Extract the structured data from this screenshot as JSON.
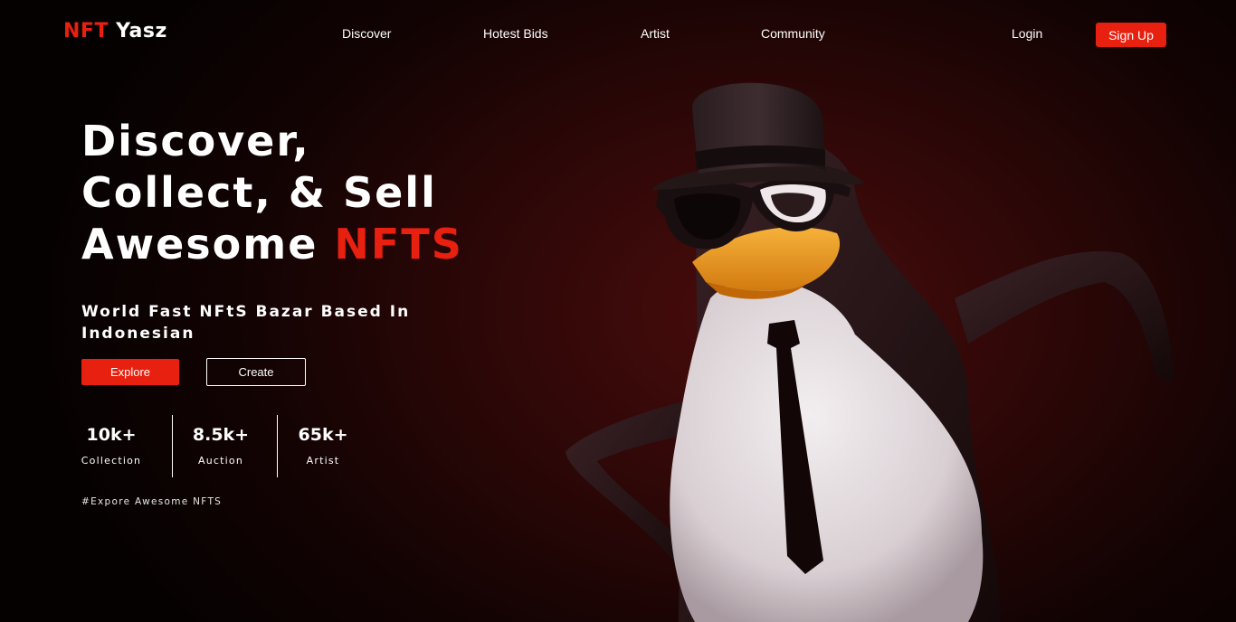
{
  "header": {
    "logo_accent": "NFT",
    "logo_rest": "Yasz",
    "nav": [
      "Discover",
      "Hotest Bids",
      "Artist",
      "Community"
    ],
    "login_label": "Login",
    "signup_label": "Sign Up"
  },
  "hero": {
    "title_line1": "Discover,",
    "title_line2": "Collect, & Sell",
    "title_line3_prefix": "Awesome ",
    "title_line3_accent": "NFTS",
    "subtitle": "World Fast NFtS Bazar Based In Indonesian",
    "explore_label": "Explore",
    "create_label": "Create",
    "stats": [
      {
        "value": "10k+",
        "label": "Collection"
      },
      {
        "value": "8.5k+",
        "label": "Auction"
      },
      {
        "value": "65k+",
        "label": "Artist"
      }
    ],
    "tagline": "#Expore Awesome NFTS",
    "image_subject": "penguin-3d-illustration"
  },
  "colors": {
    "accent": "#e8200f",
    "background_dark": "#050101",
    "background_glow": "#4a0c0c"
  }
}
